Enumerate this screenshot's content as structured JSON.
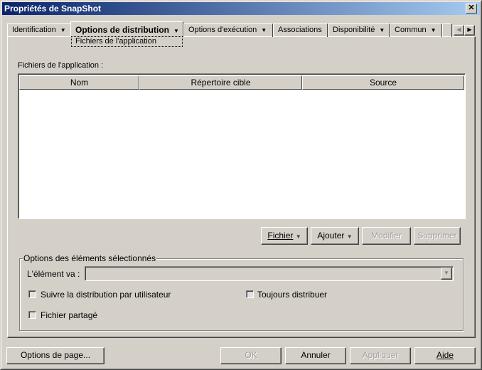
{
  "window": {
    "title": "Propriétés de SnapShot",
    "close": "✕"
  },
  "tabs": [
    {
      "label": "Identification"
    },
    {
      "label": "Options de distribution",
      "selected": true
    },
    {
      "label": "Options d'exécution"
    },
    {
      "label": "Associations"
    },
    {
      "label": "Disponibilité"
    },
    {
      "label": "Commun"
    }
  ],
  "subtab": "Fichiers de l'application",
  "files": {
    "label": "Fichiers de l'application :",
    "columns": [
      "Nom",
      "Répertoire cible",
      "Source"
    ],
    "rows": []
  },
  "actions": {
    "fichier": "Fichier",
    "ajouter": "Ajouter",
    "modifier": "Modifier",
    "supprimer": "Supprimer"
  },
  "group": {
    "legend": "Options des éléments sélectionnés",
    "element_label": "L'élément va :",
    "element_value": "",
    "suivre": "Suivre la distribution par utilisateur",
    "toujours": "Toujours distribuer",
    "partage": "Fichier partagé"
  },
  "footer": {
    "page_options": "Options de page...",
    "ok": "OK",
    "annuler": "Annuler",
    "appliquer": "Appliquer",
    "aide": "Aide"
  }
}
